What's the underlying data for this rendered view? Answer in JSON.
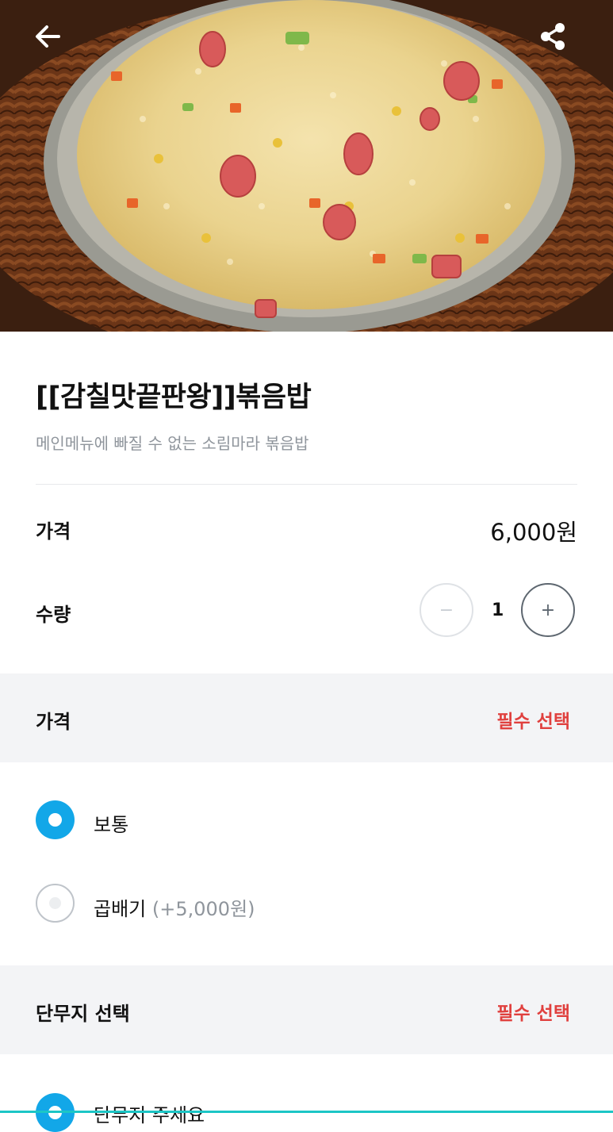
{
  "header": {
    "back_icon": "arrow-left-icon",
    "share_icon": "share-icon"
  },
  "product": {
    "title": "[[감칠맛끝판왕]]볶음밥",
    "description": "메인메뉴에 빠질 수 없는 소림마라 볶음밥"
  },
  "price": {
    "label": "가격",
    "value": "6,000원"
  },
  "quantity": {
    "label": "수량",
    "minus": "−",
    "value": "1",
    "plus": "+"
  },
  "option_groups": [
    {
      "title": "가격",
      "required": "필수 선택",
      "options": [
        {
          "label": "보통",
          "extra": "",
          "selected": true
        },
        {
          "label": "곱배기",
          "extra": "(+5,000원)",
          "selected": false
        }
      ]
    },
    {
      "title": "단무지 선택",
      "required": "필수 선택",
      "options": [
        {
          "label": "단무지 주세요",
          "extra": "",
          "selected": true
        }
      ]
    }
  ],
  "colors": {
    "accent": "#12a7e8",
    "required": "#e0403e"
  }
}
